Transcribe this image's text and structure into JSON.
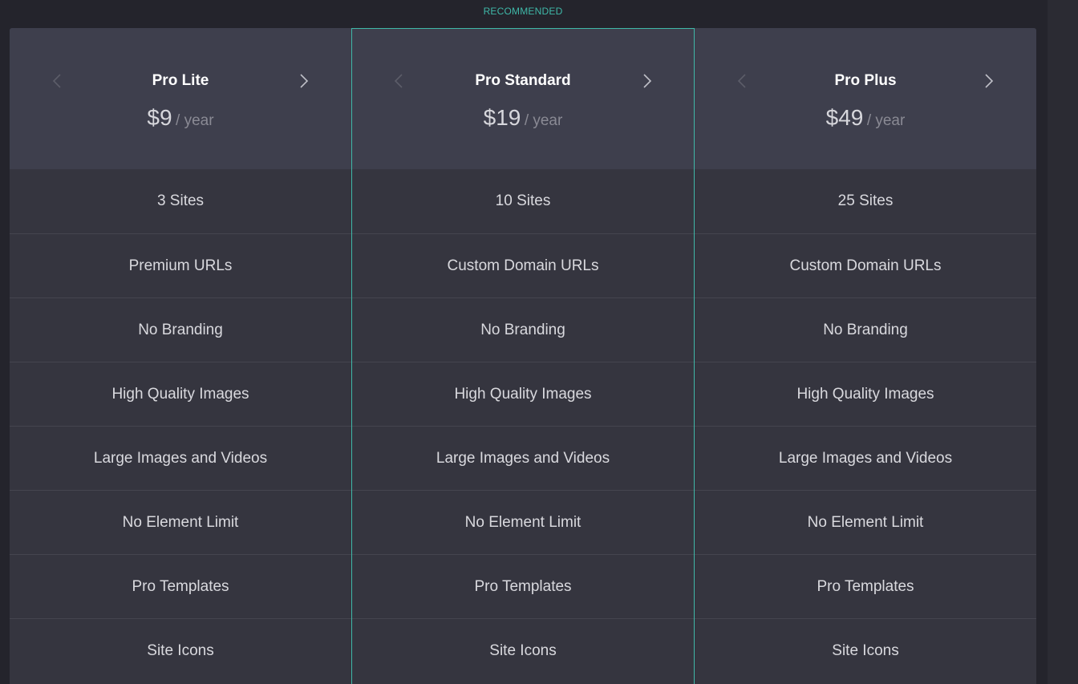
{
  "banner": {
    "recommended_label": "RECOMMENDED"
  },
  "colors": {
    "accent": "#3fb8a8",
    "header_bg": "#3e3f4d",
    "row_bg": "#35353f",
    "page_bg": "#24242c"
  },
  "icons": {
    "prev": "chevron-left-icon",
    "next": "chevron-right-icon"
  },
  "plans": [
    {
      "name": "Pro Lite",
      "price": "$9",
      "period": "/ year",
      "recommended": false,
      "features": [
        "3 Sites",
        "Premium URLs",
        "No Branding",
        "High Quality Images",
        "Large Images and Videos",
        "No Element Limit",
        "Pro Templates",
        "Site Icons"
      ]
    },
    {
      "name": "Pro Standard",
      "price": "$19",
      "period": "/ year",
      "recommended": true,
      "features": [
        "10 Sites",
        "Custom Domain URLs",
        "No Branding",
        "High Quality Images",
        "Large Images and Videos",
        "No Element Limit",
        "Pro Templates",
        "Site Icons"
      ]
    },
    {
      "name": "Pro Plus",
      "price": "$49",
      "period": "/ year",
      "recommended": false,
      "features": [
        "25 Sites",
        "Custom Domain URLs",
        "No Branding",
        "High Quality Images",
        "Large Images and Videos",
        "No Element Limit",
        "Pro Templates",
        "Site Icons"
      ]
    }
  ]
}
